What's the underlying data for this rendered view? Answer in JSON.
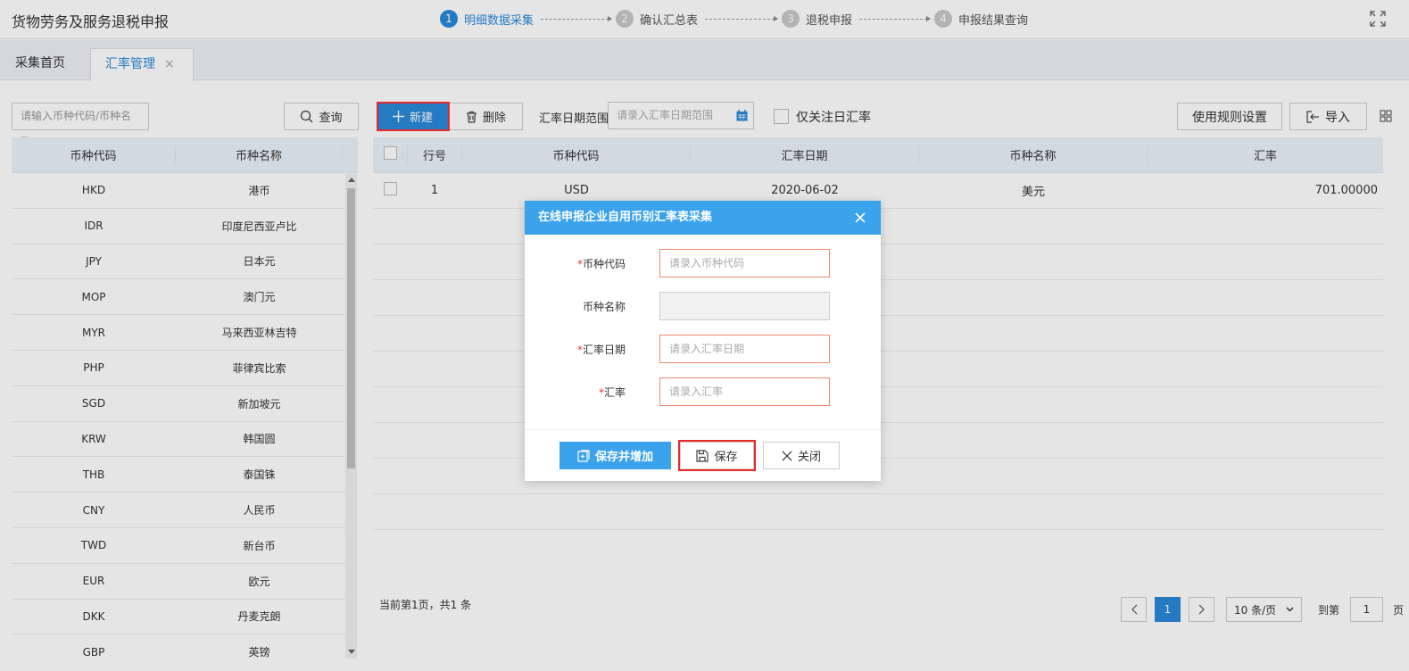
{
  "app": {
    "title": "货物劳务及服务退税申报"
  },
  "steps": [
    {
      "num": "1",
      "label": "明细数据采集",
      "active": true
    },
    {
      "num": "2",
      "label": "确认汇总表",
      "active": false
    },
    {
      "num": "3",
      "label": "退税申报",
      "active": false
    },
    {
      "num": "4",
      "label": "申报结果查询",
      "active": false
    }
  ],
  "tabs": {
    "home": "采集首页",
    "rate": "汇率管理",
    "close": "×"
  },
  "left": {
    "search_placeholder": "请输入币种代码/币种名称",
    "query_label": "查询",
    "headers": [
      "币种代码",
      "币种名称"
    ],
    "rows": [
      [
        "HKD",
        "港币"
      ],
      [
        "IDR",
        "印度尼西亚卢比"
      ],
      [
        "JPY",
        "日本元"
      ],
      [
        "MOP",
        "澳门元"
      ],
      [
        "MYR",
        "马来西亚林吉特"
      ],
      [
        "PHP",
        "菲律宾比索"
      ],
      [
        "SGD",
        "新加坡元"
      ],
      [
        "KRW",
        "韩国圆"
      ],
      [
        "THB",
        "泰国铢"
      ],
      [
        "CNY",
        "人民币"
      ],
      [
        "TWD",
        "新台币"
      ],
      [
        "EUR",
        "欧元"
      ],
      [
        "DKK",
        "丹麦克朗"
      ],
      [
        "GBP",
        "英镑"
      ]
    ]
  },
  "toolbar": {
    "new_label": "新建",
    "delete_label": "删除",
    "date_range_label": "汇率日期范围",
    "date_range_placeholder": "请录入汇率日期范围",
    "only_day_label": "仅关注日汇率",
    "rules_label": "使用规则设置",
    "import_label": "导入"
  },
  "main": {
    "headers": [
      "行号",
      "币种代码",
      "汇率日期",
      "币种名称",
      "汇率"
    ],
    "rows": [
      [
        "1",
        "USD",
        "2020-06-02",
        "美元",
        "701.00000"
      ]
    ]
  },
  "pager": {
    "info": "当前第1页，共1 条",
    "page": "1",
    "per_page": "10 条/页",
    "goto_label": "到第",
    "goto_value": "1",
    "page_suffix": "页"
  },
  "modal": {
    "title": "在线申报企业自用币别汇率表采集",
    "fields": [
      {
        "label": "币种代码",
        "required": true,
        "placeholder": "请录入币种代码"
      },
      {
        "label": "币种名称",
        "required": false,
        "placeholder": ""
      },
      {
        "label": "汇率日期",
        "required": true,
        "placeholder": "请录入汇率日期"
      },
      {
        "label": "汇率",
        "required": true,
        "placeholder": "请录入汇率"
      }
    ],
    "save_add_label": "保存并增加",
    "save_label": "保存",
    "close_label": "关闭"
  },
  "colors": {
    "accent": "#2a8ad8",
    "modal_header": "#3aa3ec",
    "highlight": "#e52a2a",
    "required": "#e23b2f"
  }
}
